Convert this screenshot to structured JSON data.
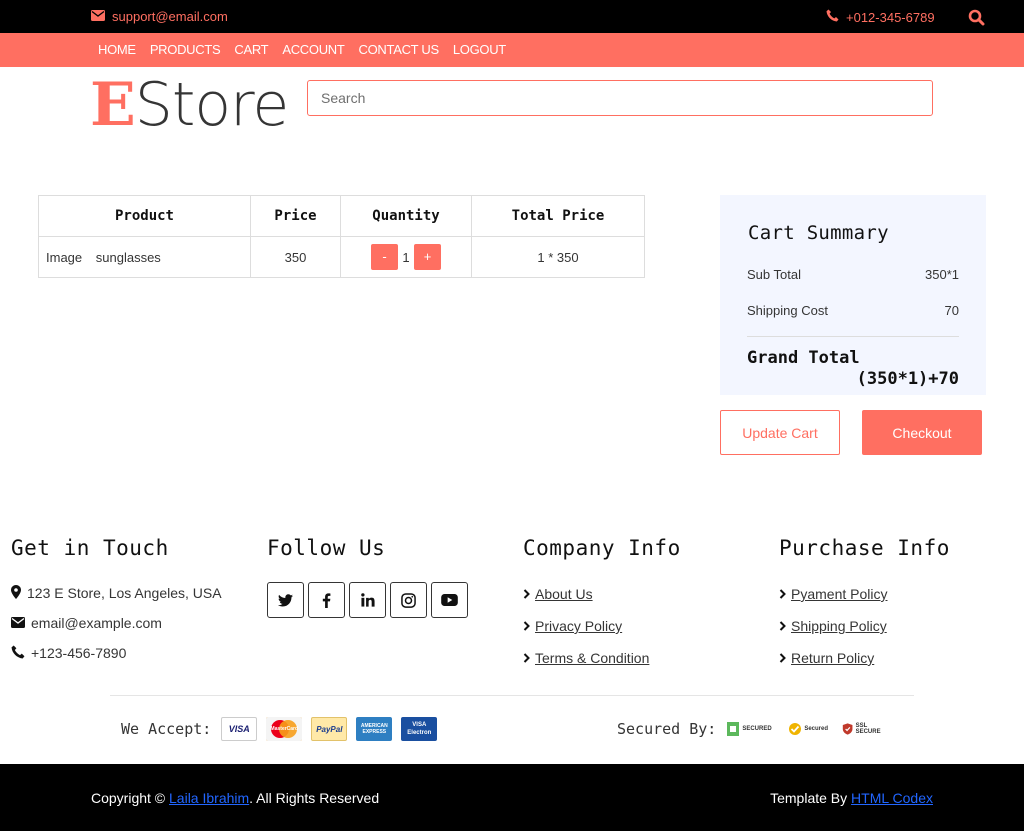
{
  "topbar": {
    "email": "support@email.com",
    "phone": "+012-345-6789"
  },
  "nav": {
    "items": [
      "HOME",
      "PRODUCTS",
      "CART",
      "ACCOUNT",
      "CONTACT US",
      "LOGOUT"
    ]
  },
  "logo": {
    "first_letter": "E",
    "rest": "Store"
  },
  "search": {
    "placeholder": "Search",
    "value": ""
  },
  "cart_table": {
    "headers": [
      "Product",
      "Price",
      "Quantity",
      "Total Price"
    ],
    "rows": [
      {
        "image_alt": "Image",
        "name": "sunglasses",
        "price": "350",
        "minus": "-",
        "quantity": "1",
        "plus": "+",
        "total": "1 * 350"
      }
    ]
  },
  "summary": {
    "title": "Cart Summary",
    "subtotal_label": "Sub Total",
    "subtotal_value": "350*1",
    "shipping_label": "Shipping Cost",
    "shipping_value": "70",
    "grand_label": "Grand Total",
    "grand_value": "(350*1)+70"
  },
  "buttons": {
    "update": "Update Cart",
    "checkout": "Checkout"
  },
  "footer": {
    "touch": {
      "title": "Get in Touch",
      "address": "123 E Store, Los Angeles, USA",
      "email": "email@example.com",
      "phone": "+123-456-7890"
    },
    "follow": {
      "title": "Follow Us",
      "icons": [
        "twitter-icon",
        "facebook-icon",
        "linkedin-icon",
        "instagram-icon",
        "youtube-icon"
      ]
    },
    "company": {
      "title": "Company Info",
      "links": [
        "About Us",
        "Privacy Policy",
        "Terms & Condition"
      ]
    },
    "purchase": {
      "title": "Purchase Info",
      "links": [
        "Pyament Policy",
        "Shipping Policy",
        "Return Policy"
      ]
    },
    "accept_label": "We Accept:",
    "cards": [
      "VISA",
      "MasterCard",
      "PayPal",
      "AMERICAN EXPRESS",
      "VISA Electron"
    ],
    "secured_label": "Secured By:",
    "badges": [
      "SECURED",
      "Secured",
      "SSL SECURE"
    ]
  },
  "bottom": {
    "copyright_prefix": "Copyright © ",
    "author": "Laila Ibrahim",
    "copyright_suffix": ". All Rights Reserved",
    "template_prefix": "Template By ",
    "template_link": "HTML Codex"
  },
  "colors": {
    "accent": "#ff6f61",
    "dark": "#000000",
    "summary_bg": "#f3f6ff",
    "link": "#2266ff"
  }
}
